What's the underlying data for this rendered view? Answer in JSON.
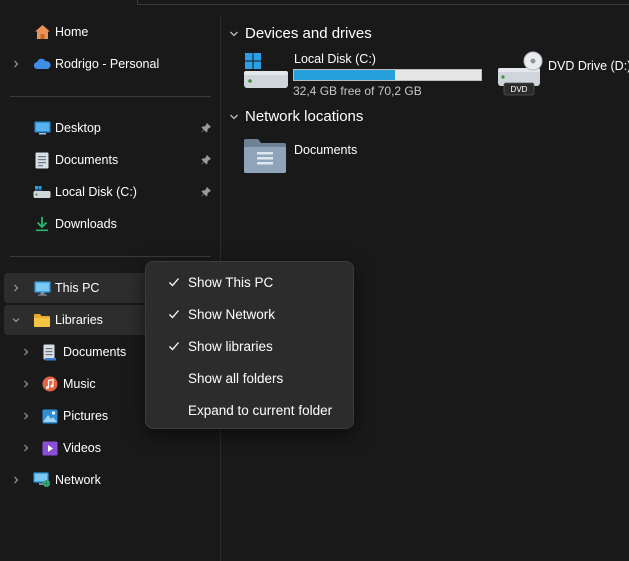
{
  "nav": {
    "home": "Home",
    "onedrive": "Rodrigo - Personal",
    "pinned": [
      "Desktop",
      "Documents",
      "Local Disk (C:)",
      "Downloads"
    ],
    "this_pc": "This PC",
    "libraries": "Libraries",
    "library_items": [
      "Documents",
      "Music",
      "Pictures",
      "Videos"
    ],
    "network": "Network"
  },
  "main": {
    "devices_title": "Devices and drives",
    "local_disk": {
      "name": "Local Disk (C:)",
      "free_text": "32,4 GB free of 70,2 GB",
      "used_fraction": 0.54
    },
    "dvd_drive": {
      "name": "DVD Drive (D:)",
      "badge": "DVD"
    },
    "network_title": "Network locations",
    "network_items": [
      "Documents"
    ]
  },
  "context_menu": {
    "items": [
      {
        "label": "Show This PC",
        "checked": true
      },
      {
        "label": "Show Network",
        "checked": true
      },
      {
        "label": "Show libraries",
        "checked": true
      },
      {
        "label": "Show all folders",
        "checked": false
      },
      {
        "label": "Expand to current folder",
        "checked": false
      }
    ]
  },
  "colors": {
    "background": "#191919",
    "accent": "#26a0da",
    "folder": "#f5c542",
    "menu_bg": "#2c2c2c"
  }
}
